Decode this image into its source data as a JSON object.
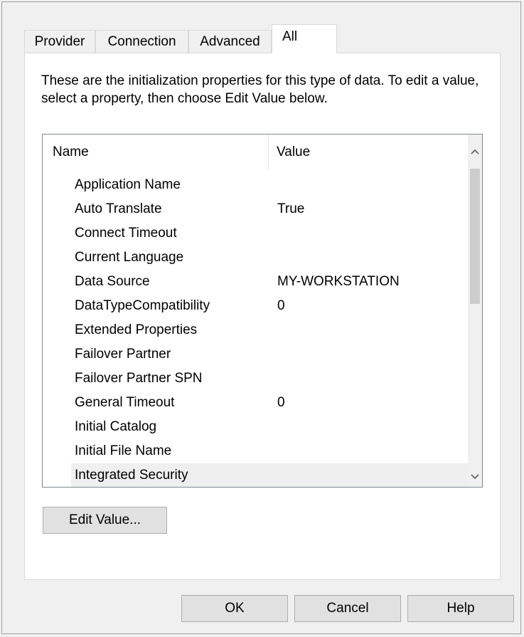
{
  "tabs": [
    {
      "label": "Provider"
    },
    {
      "label": "Connection"
    },
    {
      "label": "Advanced"
    },
    {
      "label": "All",
      "selected": true
    }
  ],
  "description": "These are the initialization properties for this type of data. To edit a value, select a property, then choose Edit Value below.",
  "list": {
    "columns": {
      "name": "Name",
      "value": "Value"
    },
    "rows": [
      {
        "name": "Application Name",
        "value": ""
      },
      {
        "name": "Auto Translate",
        "value": "True"
      },
      {
        "name": "Connect Timeout",
        "value": ""
      },
      {
        "name": "Current Language",
        "value": ""
      },
      {
        "name": "Data Source",
        "value": "MY-WORKSTATION"
      },
      {
        "name": "DataTypeCompatibility",
        "value": "0"
      },
      {
        "name": "Extended Properties",
        "value": ""
      },
      {
        "name": "Failover Partner",
        "value": ""
      },
      {
        "name": "Failover Partner SPN",
        "value": ""
      },
      {
        "name": "General Timeout",
        "value": "0"
      },
      {
        "name": "Initial Catalog",
        "value": ""
      },
      {
        "name": "Initial File Name",
        "value": ""
      },
      {
        "name": "Integrated Security",
        "value": ""
      }
    ],
    "highlighted_row": "Integrated Security"
  },
  "buttons": {
    "edit_value": "Edit Value...",
    "ok": "OK",
    "cancel": "Cancel",
    "help": "Help"
  },
  "icons": {
    "scroll_up": "chevron-up-icon",
    "scroll_down": "chevron-down-icon"
  }
}
